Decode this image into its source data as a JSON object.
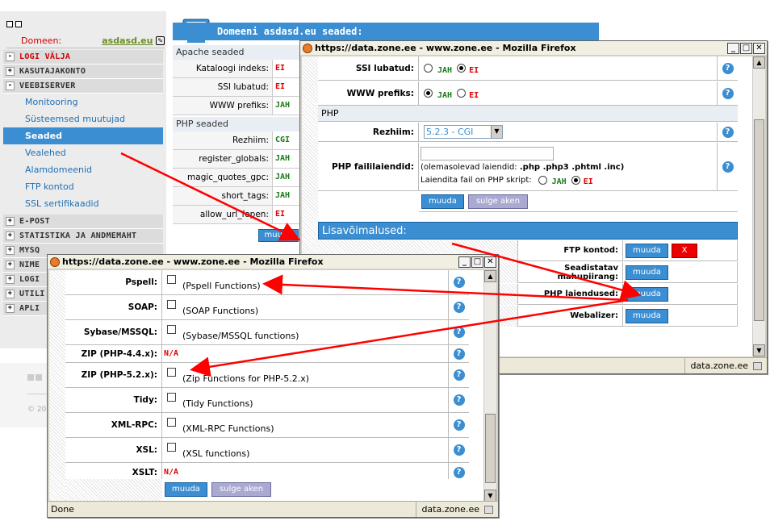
{
  "sidebar": {
    "domain_label": "Domeen:",
    "domain_value": "asdasd.eu",
    "menu_top": [
      {
        "label": "LOGI VÄLJA",
        "sign": "-"
      },
      {
        "label": "KASUTAJAKONTO",
        "sign": "+"
      },
      {
        "label": "VEEBISERVER",
        "sign": "-"
      }
    ],
    "submenu": [
      "Monitooring",
      "Süsteemsed muutujad",
      "Seaded",
      "Vealehed",
      "Alamdomeenid",
      "FTP kontod",
      "SSL sertifikaadid"
    ],
    "menu_bottom": [
      {
        "label": "E-POST",
        "sign": "+"
      },
      {
        "label": "STATISTIKA JA ANDMEMAHT",
        "sign": "+"
      },
      {
        "label": "MYSQ",
        "sign": "+"
      },
      {
        "label": "NIME",
        "sign": "+"
      },
      {
        "label": "LOGI",
        "sign": "+"
      },
      {
        "label": "UTILI",
        "sign": "+"
      },
      {
        "label": "APLI",
        "sign": "+"
      }
    ],
    "copyright": "© 20"
  },
  "page": {
    "header": "Domeeni asdasd.eu seaded:",
    "apache_title": "Apache seaded",
    "apache_rows": [
      {
        "k": "Kataloogi indeks:",
        "v": "EI"
      },
      {
        "k": "SSI lubatud:",
        "v": "EI"
      },
      {
        "k": "WWW prefiks:",
        "v": "JAH"
      }
    ],
    "php_title": "PHP seaded",
    "php_rows": [
      {
        "k": "Rezhiim:",
        "v": "CGI"
      },
      {
        "k": "register_globals:",
        "v": "JAH"
      },
      {
        "k": "magic_quotes_gpc:",
        "v": "JAH"
      },
      {
        "k": "short_tags:",
        "v": "JAH"
      },
      {
        "k": "allow_url_fopen:",
        "v": "EI"
      }
    ],
    "muuda": "muuda"
  },
  "win1": {
    "title": "https://data.zone.ee - www.zone.ee - Mozilla Firefox",
    "ssi_label": "SSI lubatud:",
    "www_label": "WWW prefiks:",
    "jah": "JAH",
    "ei": "EI",
    "php_section": "PHP",
    "rezhiim_label": "Rezhiim:",
    "rezhiim_value": "5.2.3 - CGI",
    "ext_label": "PHP faililaiendid:",
    "ext_hint_prefix": "(olemasolevad laiendid:",
    "ext_hint_values": ".php .php3 .phtml .inc)",
    "noext_label": "Laiendita fail on PHP skript:",
    "btn_muuda": "muuda",
    "btn_close": "sulge aken",
    "extras_title": "Lisavõimalused:",
    "extras": [
      {
        "label": "FTP kontod:",
        "btn": "muuda",
        "extra": "X"
      },
      {
        "label": "Seadistatav mahupiirang:",
        "btn": "muuda"
      },
      {
        "label": "PHP laiendused:",
        "btn": "muuda"
      },
      {
        "label": "Webalizer:",
        "btn": "muuda"
      }
    ],
    "status_right": "data.zone.ee"
  },
  "win2": {
    "title": "https://data.zone.ee - www.zone.ee - Mozilla Firefox",
    "rows": [
      {
        "k": "Pspell:",
        "type": "cb",
        "desc": "(Pspell Functions)"
      },
      {
        "k": "SOAP:",
        "type": "cb",
        "desc": "(SOAP Functions)"
      },
      {
        "k": "Sybase/MSSQL:",
        "type": "cb",
        "desc": "(Sybase/MSSQL functions)"
      },
      {
        "k": "ZIP (PHP-4.4.x):",
        "type": "na",
        "desc": "N/A"
      },
      {
        "k": "ZIP (PHP-5.2.x):",
        "type": "cb",
        "desc": "(Zip Functions for PHP-5.2.x)"
      },
      {
        "k": "Tidy:",
        "type": "cb",
        "desc": "(Tidy Functions)"
      },
      {
        "k": "XML-RPC:",
        "type": "cb",
        "desc": "(XML-RPC Functions)"
      },
      {
        "k": "XSL:",
        "type": "cb",
        "desc": "(XSL functions)"
      },
      {
        "k": "XSLT:",
        "type": "na",
        "desc": "N/A"
      }
    ],
    "btn_muuda": "muuda",
    "btn_close": "sulge aken",
    "status_left": "Done",
    "status_right": "data.zone.ee"
  },
  "colors": {
    "accent": "#3a8ed1",
    "alert": "#dd0000",
    "ok": "#1a7a1a",
    "arrow": "#ff0000"
  }
}
